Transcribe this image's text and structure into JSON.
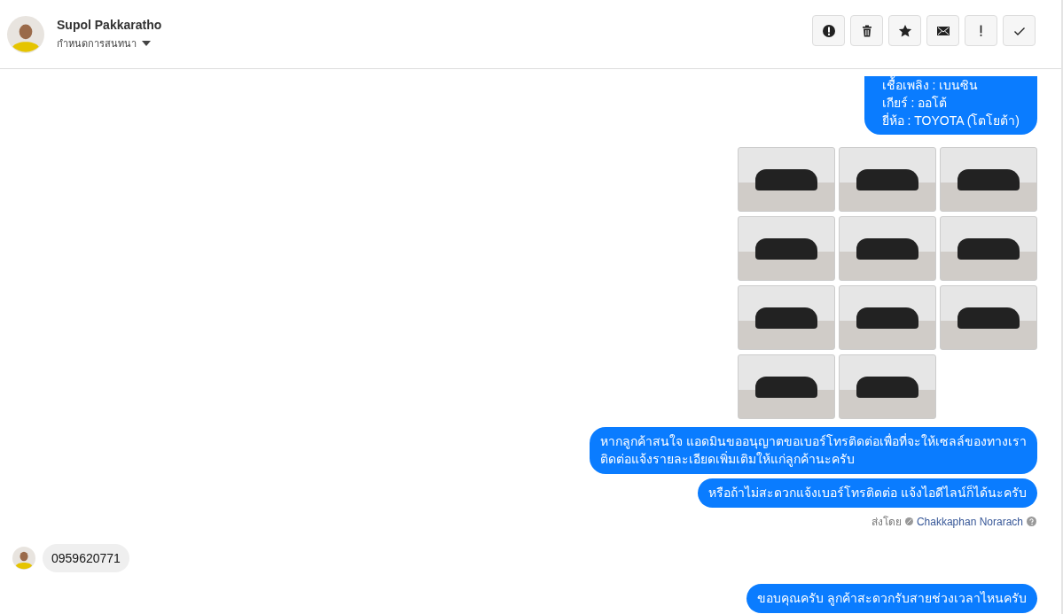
{
  "contact": {
    "name": "Supol Pakkaratho",
    "status_label": "กำหนดการสนทนา"
  },
  "messages": [
    {
      "kind": "outgoing",
      "cut_top": true,
      "text": "เชื้อเพลิง : เบนซิน\nเกียร์ : ออโต้\nยี่ห้อ : TOYOTA (โตโยต้า)"
    },
    {
      "kind": "photos"
    },
    {
      "kind": "outgoing",
      "text": "หากลูกค้าสนใจ แอดมินขออนุญาตขอเบอร์โทรติดต่อเพื่อที่จะให้เซลล์ของทางเรา\nติดต่อแจ้งรายละเอียดเพิ่มเติมให้แก่ลูกค้านะครับ"
    },
    {
      "kind": "outgoing",
      "text": "หรือถ้าไม่สะดวกแจ้งเบอร์โทรติดต่อ แจ้งไอดีไลน์ก็ได้นะครับ"
    },
    {
      "kind": "sender_note",
      "label": "ส่งโดย",
      "name": "Chakkaphan Norarach"
    },
    {
      "kind": "incoming",
      "text": "0959620771"
    },
    {
      "kind": "outgoing",
      "text": "ขอบคุณครับ ลูกค้าสะดวกรับสายช่วงเวลาไหนครับ"
    }
  ]
}
